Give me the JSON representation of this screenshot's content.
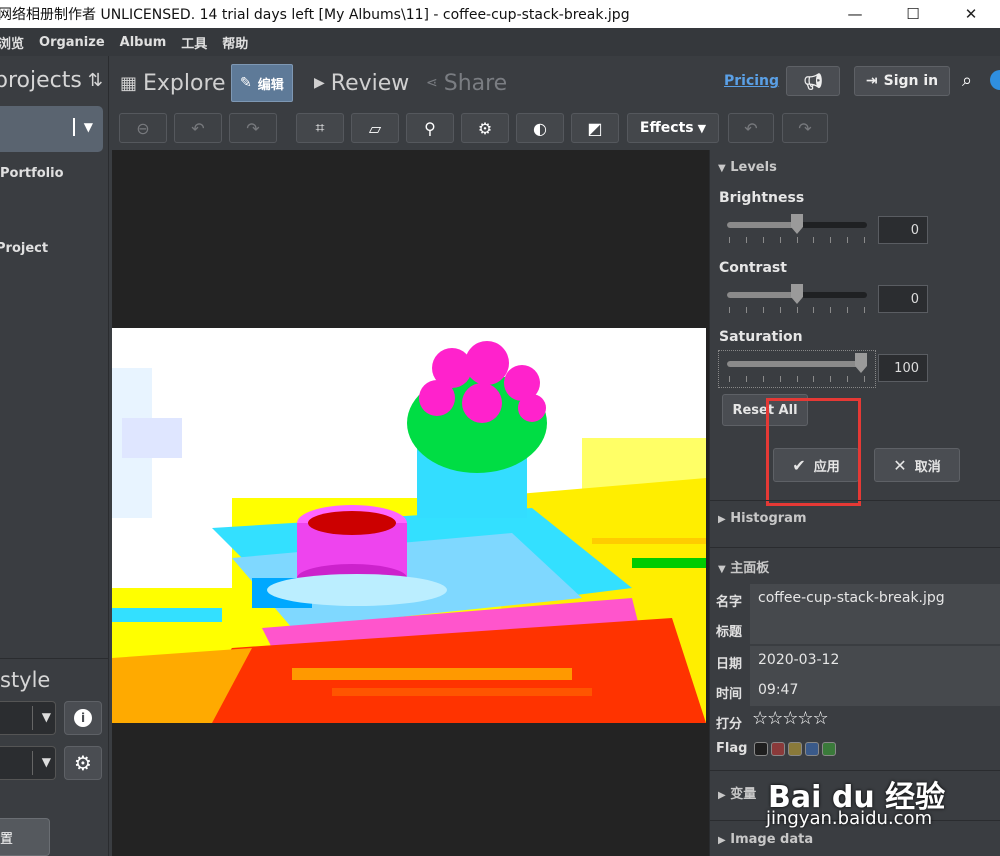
{
  "window": {
    "title": "网络相册制作者 UNLICENSED. 14 trial days left [My Albums\\11] - coffee-cup-stack-break.jpg",
    "minimize": "—",
    "maximize": "☐",
    "close": "✕"
  },
  "menu": [
    "浏览",
    "Organize",
    "Album",
    "工具",
    "帮助"
  ],
  "left": {
    "header": "projects",
    "items": [
      "Portfolio",
      "Project"
    ],
    "style_label": "style",
    "bottom_button": "置"
  },
  "nav": {
    "tabs": [
      {
        "label": "Explore",
        "icon": "grid-icon"
      },
      {
        "label": "编辑",
        "icon": "pencil-icon"
      },
      {
        "label": "Review",
        "icon": "play-icon"
      },
      {
        "label": "Share",
        "icon": "share-icon"
      }
    ],
    "pricing": "Pricing",
    "sign_in": "Sign in"
  },
  "toolbar": {
    "effects": "Effects"
  },
  "panel": {
    "levels": {
      "title": "Levels",
      "brightness": {
        "label": "Brightness",
        "value": "0",
        "level": 0.5
      },
      "contrast": {
        "label": "Contrast",
        "value": "0",
        "level": 0.5
      },
      "saturation": {
        "label": "Saturation",
        "value": "100",
        "level": 1.0
      },
      "reset_all": "Reset All",
      "apply": "应用",
      "cancel": "取消"
    },
    "histogram": "Histogram",
    "main_panel": "主面板",
    "meta": {
      "name_key": "名字",
      "name_val": "coffee-cup-stack-break.jpg",
      "title_key": "标题",
      "title_val": "",
      "date_key": "日期",
      "date_val": "2020-03-12",
      "time_key": "时间",
      "time_val": "09:47",
      "rating_key": "打分",
      "rating": 0,
      "flag_key": "Flag"
    },
    "variables": "变量",
    "image_data": "Image data"
  },
  "flag_colors": [
    "#1f1f1f",
    "#8a3a3a",
    "#8a7a3a",
    "#3a5a8a",
    "#3a7a3a"
  ],
  "watermark": {
    "logo": "Bai du 经验",
    "url": "jingyan.baidu.com"
  }
}
